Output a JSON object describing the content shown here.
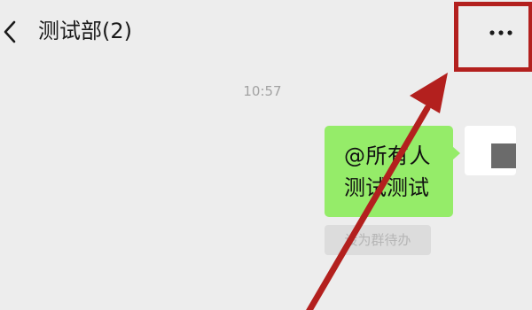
{
  "header": {
    "title": "测试部(2)",
    "back_icon": "chevron-left-icon",
    "more_icon": "more-dots-icon"
  },
  "chat": {
    "timestamp": "10:57",
    "message": {
      "mention": "@所有人",
      "text": "测试测试"
    },
    "todo_label": "设为群待办"
  },
  "colors": {
    "background": "#ededed",
    "bubble": "#95ec69",
    "annotation": "#b3201e"
  }
}
